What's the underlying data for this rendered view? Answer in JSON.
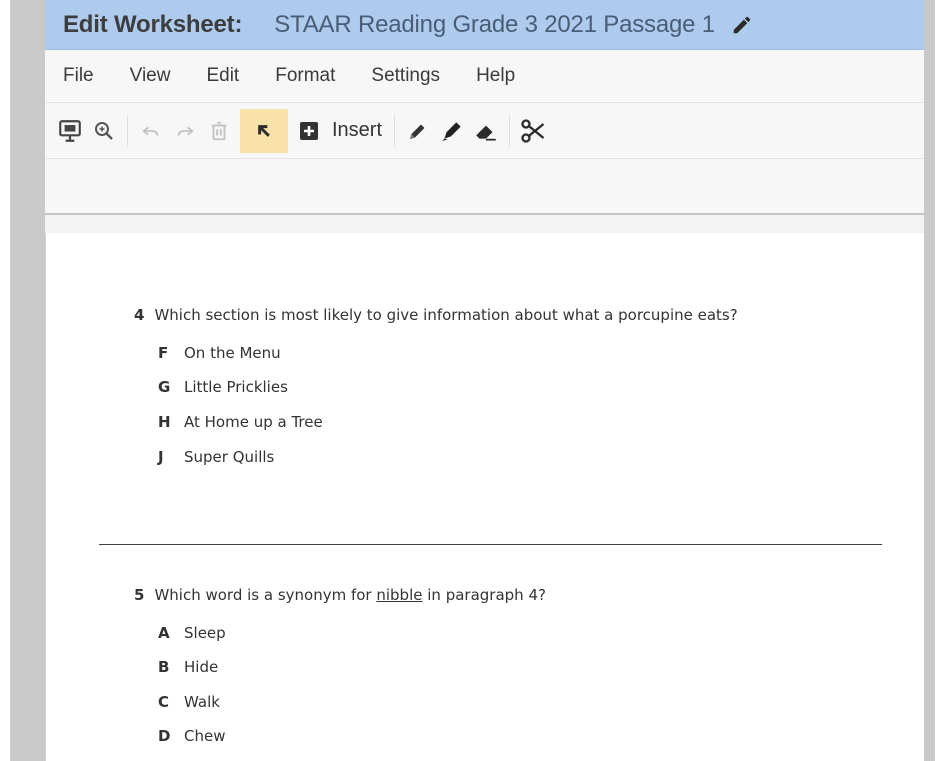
{
  "titlebar": {
    "label": "Edit Worksheet:",
    "worksheet_name": "STAAR Reading Grade 3 2021 Passage 1",
    "edit_icon": "pencil-icon"
  },
  "menubar": [
    "File",
    "View",
    "Edit",
    "Format",
    "Settings",
    "Help"
  ],
  "toolbar": {
    "insert_label": "Insert",
    "icons": [
      "presentation-icon",
      "zoom-icon",
      "undo-icon",
      "redo-icon",
      "trash-icon",
      "select-arrow-icon",
      "add-box-icon",
      "pen-icon",
      "marker-icon",
      "eraser-icon",
      "scissors-icon"
    ],
    "active_tool": "select-arrow-icon",
    "accent_active": "#f9e2aa"
  },
  "colors": {
    "titlebar_bg": "#aecbee",
    "title_name": "#4a5d76"
  },
  "questions": [
    {
      "number": "4",
      "text": "Which section is most likely to give information about what a porcupine eats?",
      "options": [
        {
          "letter": "F",
          "text": "On the Menu"
        },
        {
          "letter": "G",
          "text": "Little Pricklies"
        },
        {
          "letter": "H",
          "text": "At Home up a Tree"
        },
        {
          "letter": "J",
          "text": "Super Quills"
        }
      ]
    },
    {
      "number": "5",
      "text_before": "Which word is a synonym for ",
      "underlined": "nibble",
      "text_after": " in paragraph 4?",
      "options": [
        {
          "letter": "A",
          "text": "Sleep"
        },
        {
          "letter": "B",
          "text": "Hide"
        },
        {
          "letter": "C",
          "text": "Walk"
        },
        {
          "letter": "D",
          "text": "Chew"
        }
      ]
    }
  ]
}
